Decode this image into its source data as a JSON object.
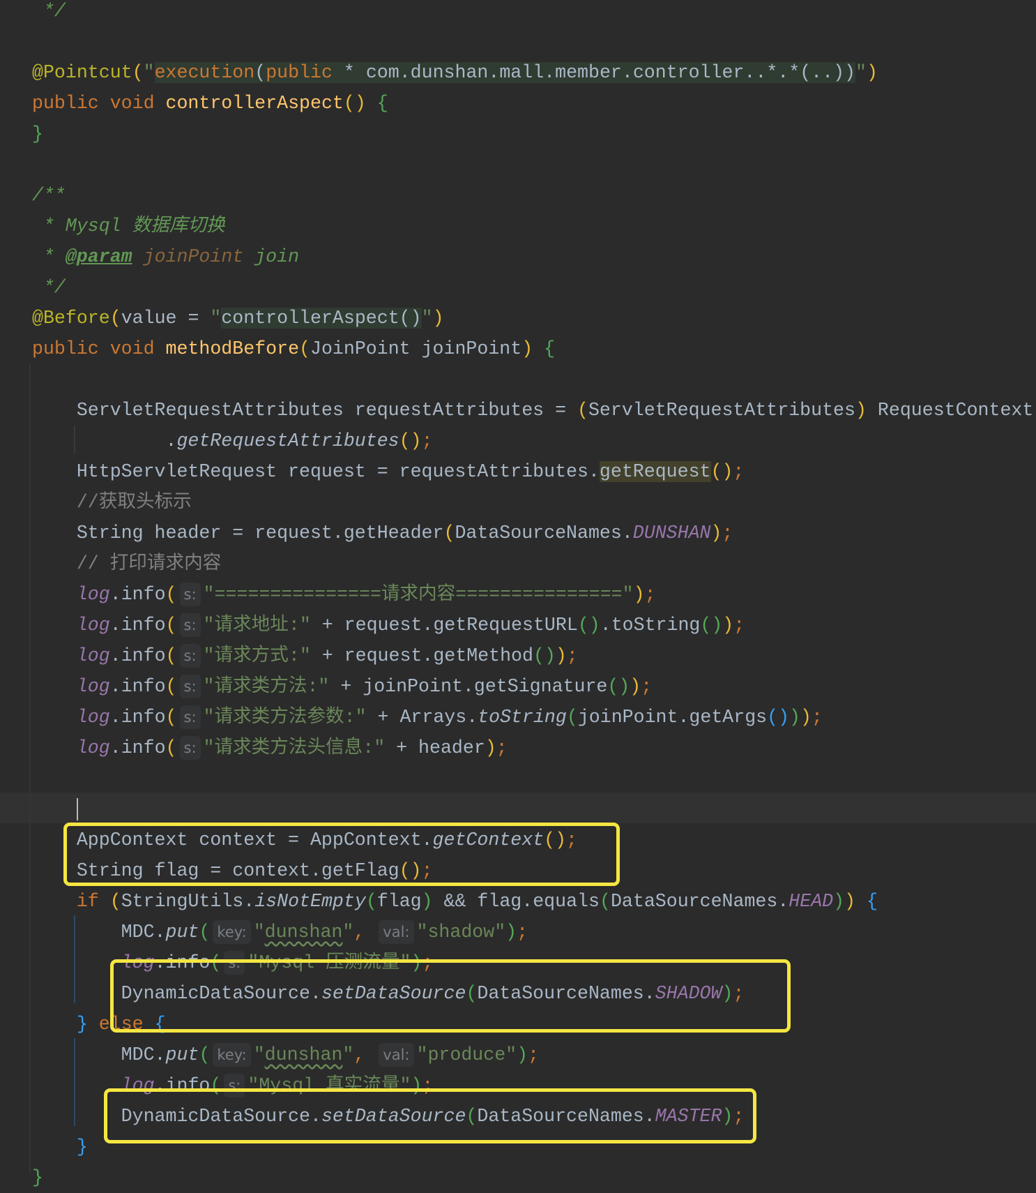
{
  "colors": {
    "background": "#2b2b2b",
    "highlight_box": "#f5e642",
    "keyword": "#cc7832",
    "string": "#6a8759",
    "annotation": "#bbb529",
    "static_field": "#9876aa"
  },
  "lines": [
    [
      [
        " */",
        "dc"
      ]
    ],
    [],
    [
      [
        "@Pointcut",
        "a"
      ],
      [
        "(",
        "y"
      ],
      [
        "\"",
        "s"
      ],
      [
        "execution",
        "k inj"
      ],
      [
        "(",
        "t inj"
      ],
      [
        "public",
        "k inj"
      ],
      [
        " * com.dunshan.mall.member.controller..*.*(..))",
        "t inj"
      ],
      [
        "\"",
        "s"
      ],
      [
        ")",
        "y"
      ]
    ],
    [
      [
        "public void ",
        "k"
      ],
      [
        "controllerAspect",
        "f"
      ],
      [
        "()",
        "y"
      ],
      [
        " ",
        "t"
      ],
      [
        "{",
        "g"
      ]
    ],
    [
      [
        "}",
        "g"
      ]
    ],
    [],
    [
      [
        "/**",
        "dc"
      ]
    ],
    [
      [
        " * Mysql 数据库切换",
        "dc"
      ]
    ],
    [
      [
        " * ",
        "dc"
      ],
      [
        "@param",
        "dt"
      ],
      [
        " ",
        "dc"
      ],
      [
        "joinPoint",
        "dp"
      ],
      [
        " join",
        "dc"
      ]
    ],
    [
      [
        " */",
        "dc"
      ]
    ],
    [
      [
        "@Before",
        "a"
      ],
      [
        "(",
        "y"
      ],
      [
        "value = ",
        "t"
      ],
      [
        "\"",
        "s"
      ],
      [
        "controllerAspect()",
        "t inj"
      ],
      [
        "\"",
        "s"
      ],
      [
        ")",
        "y"
      ]
    ],
    [
      [
        "public void ",
        "k"
      ],
      [
        "methodBefore",
        "f"
      ],
      [
        "(",
        "y"
      ],
      [
        "JoinPoint joinPoint",
        "t"
      ],
      [
        ")",
        "y"
      ],
      [
        " ",
        "t"
      ],
      [
        "{",
        "g"
      ]
    ],
    [],
    [
      [
        "    ServletRequestAttributes requestAttributes = ",
        "t"
      ],
      [
        "(",
        "y"
      ],
      [
        "ServletRequestAttributes",
        "t"
      ],
      [
        ")",
        "y"
      ],
      [
        " RequestContext",
        "t"
      ]
    ],
    [
      [
        "            .",
        "t"
      ],
      [
        "getRequestAttributes",
        "i"
      ],
      [
        "()",
        "y"
      ],
      [
        ";",
        "sc"
      ]
    ],
    [
      [
        "    HttpServletRequest request = requestAttributes.",
        "t"
      ],
      [
        "getRequest",
        "t hl"
      ],
      [
        "()",
        "y"
      ],
      [
        ";",
        "sc"
      ]
    ],
    [
      [
        "    //获取头标示",
        "c"
      ]
    ],
    [
      [
        "    String header = request.getHeader",
        "t"
      ],
      [
        "(",
        "y"
      ],
      [
        "DataSourceNames.",
        "t"
      ],
      [
        "DUNSHAN",
        "st"
      ],
      [
        ")",
        "y"
      ],
      [
        ";",
        "sc"
      ]
    ],
    [
      [
        "    // 打印请求内容",
        "c"
      ]
    ],
    [
      [
        "    ",
        "t"
      ],
      [
        "log",
        "lg"
      ],
      [
        ".info",
        "t"
      ],
      [
        "(",
        "y"
      ],
      [
        "s:",
        "h"
      ],
      [
        "\"===============请求内容===============\"",
        "s"
      ],
      [
        ")",
        "y"
      ],
      [
        ";",
        "sc"
      ]
    ],
    [
      [
        "    ",
        "t"
      ],
      [
        "log",
        "lg"
      ],
      [
        ".info",
        "t"
      ],
      [
        "(",
        "y"
      ],
      [
        "s:",
        "h"
      ],
      [
        "\"请求地址:\"",
        "s"
      ],
      [
        " + request.getRequestURL",
        "t"
      ],
      [
        "()",
        "g"
      ],
      [
        ".toString",
        "t"
      ],
      [
        "()",
        "g"
      ],
      [
        ")",
        "y"
      ],
      [
        ";",
        "sc"
      ]
    ],
    [
      [
        "    ",
        "t"
      ],
      [
        "log",
        "lg"
      ],
      [
        ".info",
        "t"
      ],
      [
        "(",
        "y"
      ],
      [
        "s:",
        "h"
      ],
      [
        "\"请求方式:\"",
        "s"
      ],
      [
        " + request.getMethod",
        "t"
      ],
      [
        "()",
        "g"
      ],
      [
        ")",
        "y"
      ],
      [
        ";",
        "sc"
      ]
    ],
    [
      [
        "    ",
        "t"
      ],
      [
        "log",
        "lg"
      ],
      [
        ".info",
        "t"
      ],
      [
        "(",
        "y"
      ],
      [
        "s:",
        "h"
      ],
      [
        "\"请求类方法:\"",
        "s"
      ],
      [
        " + joinPoint.getSignature",
        "t"
      ],
      [
        "()",
        "g"
      ],
      [
        ")",
        "y"
      ],
      [
        ";",
        "sc"
      ]
    ],
    [
      [
        "    ",
        "t"
      ],
      [
        "log",
        "lg"
      ],
      [
        ".info",
        "t"
      ],
      [
        "(",
        "y"
      ],
      [
        "s:",
        "h"
      ],
      [
        "\"请求类方法参数:\"",
        "s"
      ],
      [
        " + Arrays.",
        "t"
      ],
      [
        "toString",
        "i"
      ],
      [
        "(",
        "g"
      ],
      [
        "joinPoint.getArgs",
        "t"
      ],
      [
        "()",
        "b"
      ],
      [
        ")",
        "g"
      ],
      [
        ")",
        "y"
      ],
      [
        ";",
        "sc"
      ]
    ],
    [
      [
        "    ",
        "t"
      ],
      [
        "log",
        "lg"
      ],
      [
        ".info",
        "t"
      ],
      [
        "(",
        "y"
      ],
      [
        "s:",
        "h"
      ],
      [
        "\"请求类方法头信息:\"",
        "s"
      ],
      [
        " + header",
        "t"
      ],
      [
        ")",
        "y"
      ],
      [
        ";",
        "sc"
      ]
    ],
    [],
    [
      [
        "    ",
        "caret"
      ]
    ],
    [
      [
        "    AppContext context = AppContext.",
        "t"
      ],
      [
        "getContext",
        "i"
      ],
      [
        "()",
        "y"
      ],
      [
        ";",
        "sc"
      ]
    ],
    [
      [
        "    String flag = context.getFlag",
        "t"
      ],
      [
        "()",
        "y"
      ],
      [
        ";",
        "sc"
      ]
    ],
    [
      [
        "    ",
        "t"
      ],
      [
        "if",
        "k"
      ],
      [
        " ",
        "t"
      ],
      [
        "(",
        "y"
      ],
      [
        "StringUtils.",
        "t"
      ],
      [
        "isNotEmpty",
        "i"
      ],
      [
        "(",
        "g"
      ],
      [
        "flag",
        "t"
      ],
      [
        ")",
        "g"
      ],
      [
        " && flag.equals",
        "t"
      ],
      [
        "(",
        "g"
      ],
      [
        "DataSourceNames.",
        "t"
      ],
      [
        "HEAD",
        "st"
      ],
      [
        ")",
        "g"
      ],
      [
        ")",
        "y"
      ],
      [
        " ",
        "t"
      ],
      [
        "{",
        "b"
      ]
    ],
    [
      [
        "        MDC.",
        "t"
      ],
      [
        "put",
        "i"
      ],
      [
        "(",
        "g"
      ],
      [
        "key:",
        "h"
      ],
      [
        "\"",
        "s"
      ],
      [
        "dunshan",
        "s wavy"
      ],
      [
        "\"",
        "s"
      ],
      [
        ",",
        "sc"
      ],
      [
        " ",
        "t"
      ],
      [
        "val:",
        "h"
      ],
      [
        "\"shadow\"",
        "s"
      ],
      [
        ")",
        "g"
      ],
      [
        ";",
        "sc"
      ]
    ],
    [
      [
        "        ",
        "t"
      ],
      [
        "log",
        "lg"
      ],
      [
        ".info",
        "t"
      ],
      [
        "(",
        "g"
      ],
      [
        "s:",
        "h"
      ],
      [
        "\"Mysql 压测流量\"",
        "s"
      ],
      [
        ")",
        "g"
      ],
      [
        ";",
        "sc"
      ]
    ],
    [
      [
        "        DynamicDataSource.",
        "t"
      ],
      [
        "setDataSource",
        "i"
      ],
      [
        "(",
        "g"
      ],
      [
        "DataSourceNames.",
        "t"
      ],
      [
        "SHADOW",
        "st"
      ],
      [
        ")",
        "g"
      ],
      [
        ";",
        "sc"
      ]
    ],
    [
      [
        "    ",
        "t"
      ],
      [
        "}",
        "b"
      ],
      [
        " ",
        "t"
      ],
      [
        "else",
        "k"
      ],
      [
        " ",
        "t"
      ],
      [
        "{",
        "b"
      ]
    ],
    [
      [
        "        MDC.",
        "t"
      ],
      [
        "put",
        "i"
      ],
      [
        "(",
        "g"
      ],
      [
        "key:",
        "h"
      ],
      [
        "\"",
        "s"
      ],
      [
        "dunshan",
        "s wavy"
      ],
      [
        "\"",
        "s"
      ],
      [
        ",",
        "sc"
      ],
      [
        " ",
        "t"
      ],
      [
        "val:",
        "h"
      ],
      [
        "\"produce\"",
        "s"
      ],
      [
        ")",
        "g"
      ],
      [
        ";",
        "sc"
      ]
    ],
    [
      [
        "        ",
        "t"
      ],
      [
        "log",
        "lg"
      ],
      [
        ".info",
        "t"
      ],
      [
        "(",
        "g"
      ],
      [
        "s:",
        "h"
      ],
      [
        "\"Mysql 真实流量\"",
        "s"
      ],
      [
        ")",
        "g"
      ],
      [
        ";",
        "sc"
      ]
    ],
    [
      [
        "        DynamicDataSource.",
        "t"
      ],
      [
        "setDataSource",
        "i"
      ],
      [
        "(",
        "g"
      ],
      [
        "DataSourceNames.",
        "t"
      ],
      [
        "MASTER",
        "st"
      ],
      [
        ")",
        "g"
      ],
      [
        ";",
        "sc"
      ]
    ],
    [
      [
        "    ",
        "t"
      ],
      [
        "}",
        "b"
      ]
    ],
    [
      [
        "}",
        "g"
      ]
    ]
  ]
}
